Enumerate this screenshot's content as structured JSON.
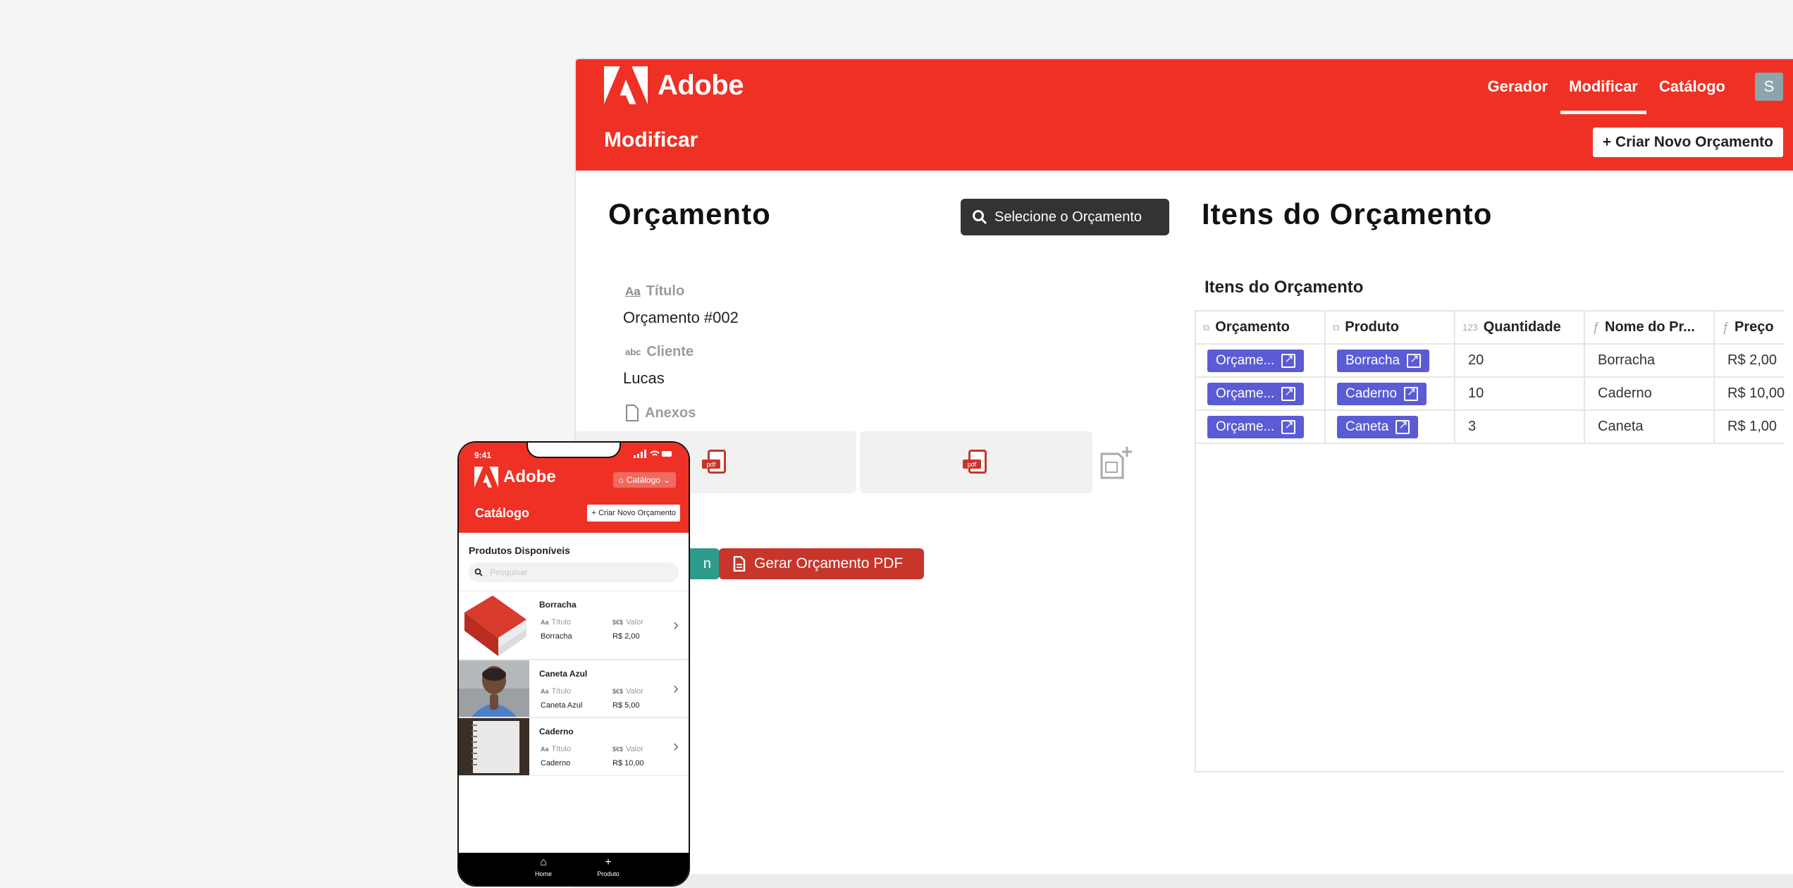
{
  "desktop": {
    "logo_text": "Adobe",
    "nav": [
      {
        "label": "Gerador"
      },
      {
        "label": "Modificar",
        "active": true
      },
      {
        "label": "Catálogo"
      }
    ],
    "avatar_initial": "S",
    "subheader_title": "Modificar",
    "new_button": "+ Criar Novo Orçamento",
    "left": {
      "heading": "Orçamento",
      "search_button": "Selecione o Orçamento",
      "fields": [
        {
          "icon": "Aa",
          "label": "Título",
          "value": "Orçamento #002"
        },
        {
          "icon": "abc",
          "label": "Cliente",
          "value": "Lucas"
        }
      ],
      "attachments_label": "Anexos",
      "green_button": "n",
      "pdf_button": "Gerar Orçamento PDF"
    },
    "right": {
      "heading": "Itens do Orçamento",
      "table_caption": "Itens do Orçamento",
      "columns": [
        {
          "icon": "⧉",
          "label": "Orçamento"
        },
        {
          "icon": "⧉",
          "label": "Produto"
        },
        {
          "icon": "123",
          "label": "Quantidade"
        },
        {
          "icon": "ƒ",
          "label": "Nome do Pr..."
        },
        {
          "icon": "ƒ",
          "label": "Preço"
        }
      ],
      "rows": [
        {
          "orcamento": "Orçame...",
          "produto": "Borracha",
          "quantidade": "20",
          "nome": "Borracha",
          "preco": "R$ 2,00"
        },
        {
          "orcamento": "Orçame...",
          "produto": "Caderno",
          "quantidade": "10",
          "nome": "Caderno",
          "preco": "R$ 10,00"
        },
        {
          "orcamento": "Orçame...",
          "produto": "Caneta",
          "quantidade": "3",
          "nome": "Caneta",
          "preco": "R$ 1,00"
        }
      ]
    }
  },
  "phone": {
    "time": "9:41",
    "logo_text": "Adobe",
    "menu_button": "Catálogo",
    "title": "Catálogo",
    "new_button": "+ Criar Novo Orçamento",
    "section_title": "Produtos Disponíveis",
    "search_placeholder": "Pesquisar",
    "products": [
      {
        "name": "Borracha",
        "title_label": "Título",
        "title_value": "Borracha",
        "value_label": "Valor",
        "value": "R$ 2,00"
      },
      {
        "name": "Caneta Azul",
        "title_label": "Título",
        "title_value": "Caneta Azul",
        "value_label": "Valor",
        "value": "R$ 5,00"
      },
      {
        "name": "Caderno",
        "title_label": "Título",
        "title_value": "Caderno",
        "value_label": "Valor",
        "value": "R$ 10,00"
      }
    ],
    "tabs": [
      {
        "label": "Home",
        "icon": "home-icon"
      },
      {
        "label": "Produto",
        "icon": "plus-icon"
      }
    ]
  },
  "colors": {
    "brand_red": "#ee3124",
    "chip_purple": "#5b5bd6",
    "pdf_red": "#c8352b",
    "teal": "#2e9a8c"
  }
}
